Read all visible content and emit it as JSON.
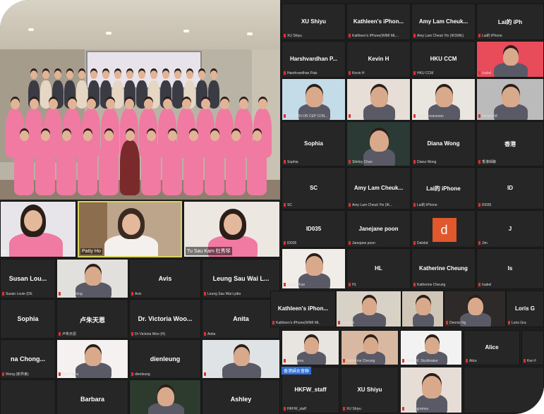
{
  "group_photo": {
    "people_count": 48,
    "jacket_color": "#f07aa2"
  },
  "left_video_row": [
    {
      "caption": "U"
    },
    {
      "caption": "Patty Ho"
    },
    {
      "caption": "Tu Sau Kam 杜秀琴"
    }
  ],
  "left_grid": [
    {
      "name": "Susan Lou...",
      "caption": "Susan Louie (DE"
    },
    {
      "name": "",
      "caption": "Candy Wong"
    },
    {
      "name": "Avis",
      "caption": "Avis"
    },
    {
      "name": "Leung Sau Wai L...",
      "caption": "Leung Sau Wai Lydia"
    },
    {
      "name": "Sophia",
      "caption": ""
    },
    {
      "name": "卢朱天恩",
      "caption": "卢朱天恩"
    },
    {
      "name": "Dr. Victoria Woo...",
      "caption": "Dr Victoria Woo (H)"
    },
    {
      "name": "Anita",
      "caption": "Anita"
    },
    {
      "name": "na Chong...",
      "caption": "Wong (新界東)"
    },
    {
      "name": "",
      "caption": "Karl Pamu"
    },
    {
      "name": "dienleung",
      "caption": "dienleung"
    },
    {
      "name": "",
      "caption": "amyof93"
    },
    {
      "name": "",
      "caption": ""
    },
    {
      "name": "Barbara",
      "caption": ""
    },
    {
      "name": "",
      "caption": ""
    },
    {
      "name": "Ashley",
      "caption": ""
    }
  ],
  "right_grid_top": [
    {
      "name": "XU Shiyu",
      "caption": "XU Shiyu"
    },
    {
      "name": "Kathleen's iPhon...",
      "caption": "Kathleen's iPhone(WIMI ML..."
    },
    {
      "name": "Amy Lam Cheuk...",
      "caption": "Amy Lam Cheuk Yin (IKSWE)"
    },
    {
      "name": "Lai的 iPh",
      "caption": "Lai的 iPhone"
    },
    {
      "name": "Harshvardhan P...",
      "caption": "Harshvardhan Pais"
    },
    {
      "name": "Kevin H",
      "caption": "Kevin H"
    },
    {
      "name": "HKU CCM",
      "caption": "HKU CCM"
    },
    {
      "name": "",
      "caption": "Isabel"
    },
    {
      "name": "",
      "caption": "W POON DR CEP CON..."
    },
    {
      "name": "",
      "caption": "Vicki"
    },
    {
      "name": "",
      "caption": "Jerry Devanesan"
    },
    {
      "name": "",
      "caption": "Serena M"
    },
    {
      "name": "Sophia",
      "caption": "Sophia"
    },
    {
      "name": "",
      "caption": "Shirley Chan"
    },
    {
      "name": "Diana Wong",
      "caption": "Diana Wong"
    },
    {
      "name": "香港",
      "caption": "香港婦聯"
    },
    {
      "name": "SC",
      "caption": "SC"
    },
    {
      "name": "Amy Lam Cheuk...",
      "caption": "Amy Lam Cheuk Yin (IK..."
    },
    {
      "name": "Lai的 iPhone",
      "caption": "Lai的 iPhone"
    },
    {
      "name": "ID",
      "caption": "ID035"
    },
    {
      "name": "ID035",
      "caption": "ID035"
    },
    {
      "name": "Janejane poon",
      "caption": "Janejane poon"
    },
    {
      "name": "d",
      "caption": "Dalxbd"
    },
    {
      "name": "J",
      "caption": "Jim"
    },
    {
      "name": "",
      "caption": "Evelyn Kan"
    },
    {
      "name": "HL",
      "caption": "HL"
    },
    {
      "name": "Katherine Cheung",
      "caption": "Katherine Cheung"
    },
    {
      "name": "Is",
      "caption": "Isabel"
    }
  ],
  "right_grid_bottom": [
    {
      "name": "Kathleen's iPhon...",
      "caption": "Kathleen's iPhone(WIMI ML"
    },
    {
      "name": "",
      "caption": "Sudhani"
    },
    {
      "name": "",
      "caption": ""
    },
    {
      "name": "",
      "caption": "Dennis Ng"
    },
    {
      "name": "Loris G",
      "caption": "Loris Gra"
    },
    {
      "name": "",
      "caption": "Karl Pamu"
    },
    {
      "name": "",
      "caption": "Katherine Cheung"
    },
    {
      "name": "",
      "caption": "Zoom M. Skullmaker"
    },
    {
      "name": "Alice",
      "caption": "Alice"
    },
    {
      "name": "",
      "caption": "Ken F"
    },
    {
      "name": "HKFW_staff",
      "caption": "HKFW_staff"
    },
    {
      "name": "XU Shiyu",
      "caption": "XU Shiyu"
    },
    {
      "name": "",
      "caption": "Pia Magrames"
    },
    {
      "name": "",
      "caption": ""
    }
  ],
  "highlight_label": "香港婦女會聯",
  "colors": {
    "tile_bg": "#262626",
    "border": "#151515",
    "mic_muted": "#e03030",
    "avatar_d": "#e0582b",
    "speaker_border": "#d9d35a"
  }
}
